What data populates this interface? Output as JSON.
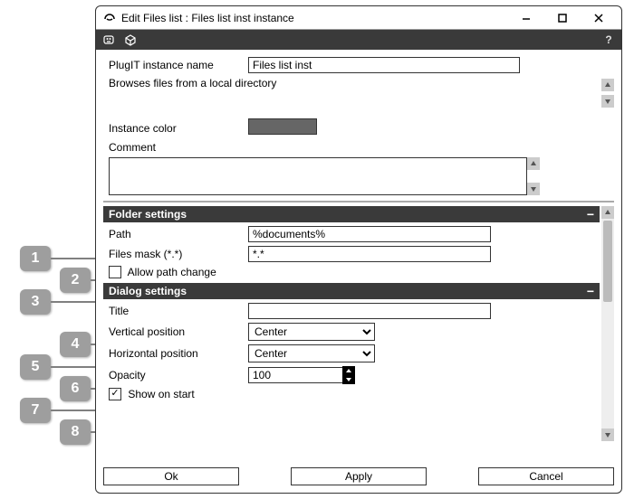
{
  "window": {
    "title": "Edit Files list : Files list inst instance"
  },
  "upper": {
    "name_label": "PlugIT instance name",
    "name_value": "Files list inst",
    "description": "Browses files from a local directory",
    "color_label": "Instance color",
    "comment_label": "Comment",
    "comment_value": ""
  },
  "folder": {
    "header": "Folder settings",
    "path_label": "Path",
    "path_value": "%documents%",
    "mask_label": "Files mask (*.*)",
    "mask_value": "*.*",
    "allow_change_label": "Allow path change",
    "allow_change_checked": false
  },
  "dialog": {
    "header": "Dialog settings",
    "title_label": "Title",
    "title_value": "",
    "vpos_label": "Vertical position",
    "vpos_value": "Center",
    "hpos_label": "Horizontal position",
    "hpos_value": "Center",
    "opacity_label": "Opacity",
    "opacity_value": "100",
    "show_label": "Show on start",
    "show_checked": true
  },
  "buttons": {
    "ok": "Ok",
    "apply": "Apply",
    "cancel": "Cancel"
  },
  "callouts": [
    "1",
    "2",
    "3",
    "4",
    "5",
    "6",
    "7",
    "8"
  ]
}
